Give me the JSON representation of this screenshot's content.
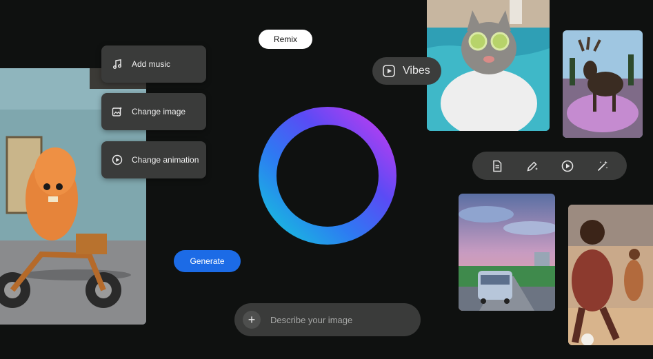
{
  "header": {
    "remix_label": "Remix"
  },
  "menu": {
    "items": [
      {
        "label": "Add music",
        "icon": "music-note-icon"
      },
      {
        "label": "Change image",
        "icon": "image-edit-icon"
      },
      {
        "label": "Change animation",
        "icon": "play-circle-icon"
      }
    ]
  },
  "vibes": {
    "label": "Vibes",
    "icon": "play-square-icon"
  },
  "actions": {
    "generate_label": "Generate"
  },
  "prompt": {
    "placeholder": "Describe your image",
    "value": "",
    "add_icon": "plus-icon"
  },
  "toolbar": {
    "tools": [
      "document-icon",
      "pencil-sparkle-icon",
      "play-circle-icon",
      "magic-wand-icon"
    ]
  },
  "colors": {
    "background": "#0f1110",
    "accent_blue": "#1c6be6",
    "ring_gradient": [
      "#c23cf0",
      "#5a4bf5",
      "#2d7bf2",
      "#16c2dc"
    ]
  }
}
